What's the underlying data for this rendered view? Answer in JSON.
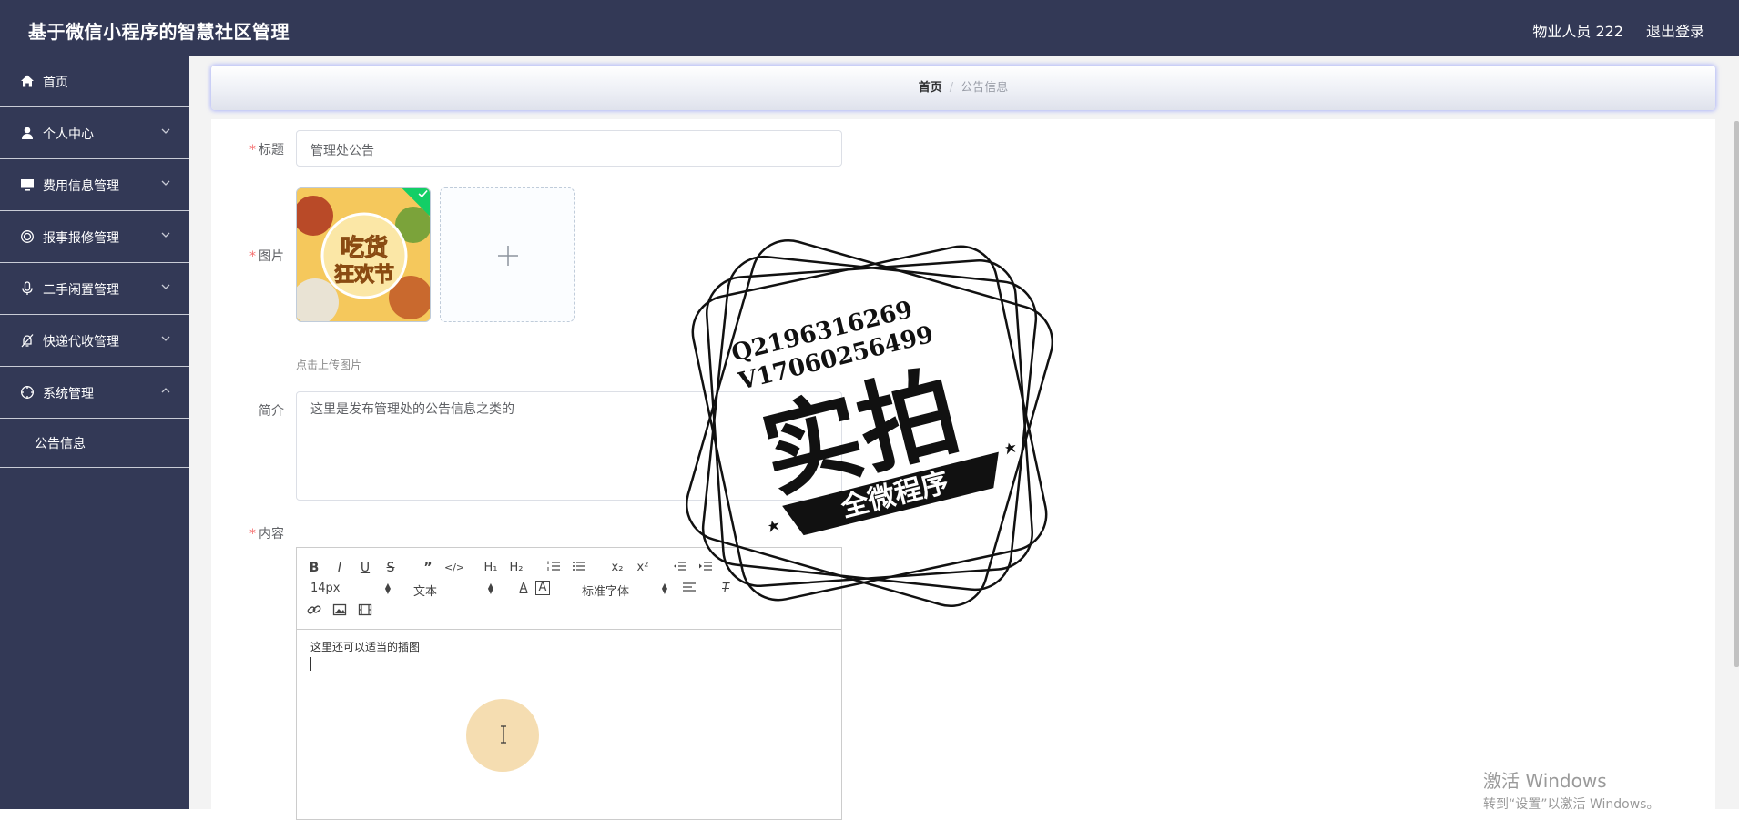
{
  "header": {
    "app_title": "基于微信小程序的智慧社区管理",
    "user_label": "物业人员 222",
    "logout_label": "退出登录"
  },
  "sidebar": {
    "items": [
      {
        "label": "首页",
        "icon": "home-icon",
        "expandable": false
      },
      {
        "label": "个人中心",
        "icon": "user-icon",
        "expandable": true,
        "expanded": false
      },
      {
        "label": "费用信息管理",
        "icon": "monitor-icon",
        "expandable": true,
        "expanded": false
      },
      {
        "label": "报事报修管理",
        "icon": "service-icon",
        "expandable": true,
        "expanded": false
      },
      {
        "label": "二手闲置管理",
        "icon": "microphone-icon",
        "expandable": true,
        "expanded": false
      },
      {
        "label": "快递代收管理",
        "icon": "bell-off-icon",
        "expandable": true,
        "expanded": false
      },
      {
        "label": "系统管理",
        "icon": "compass-icon",
        "expandable": true,
        "expanded": true
      }
    ],
    "subitems": [
      {
        "label": "公告信息"
      }
    ]
  },
  "breadcrumb": {
    "home": "首页",
    "separator": "/",
    "current": "公告信息"
  },
  "form": {
    "title_label": "标题",
    "title_value": "管理处公告",
    "image_label": "图片",
    "upload_tip": "点击上传图片",
    "image_thumb_text": {
      "line1": "吃货",
      "line2": "狂欢节"
    },
    "summary_label": "简介",
    "summary_value": "这里是发布管理处的公告信息之类的",
    "content_label": "内容"
  },
  "editor": {
    "font_size": "14px",
    "paragraph_type": "文本",
    "font_family": "标准字体",
    "body_text": "这里还可以适当的插图"
  },
  "watermark": {
    "line1": "Q2196316269",
    "line2": "V17060256499",
    "big": "实拍",
    "banner": "全微程序"
  },
  "os_overlay": {
    "line1": "激活 Windows",
    "line2": "转到“设置”以激活 Windows。"
  },
  "colors": {
    "nav_bg": "#333956",
    "required": "#f56c6c",
    "upload_success": "#13ce66",
    "breadcrumb_glow": "#7684ff"
  }
}
